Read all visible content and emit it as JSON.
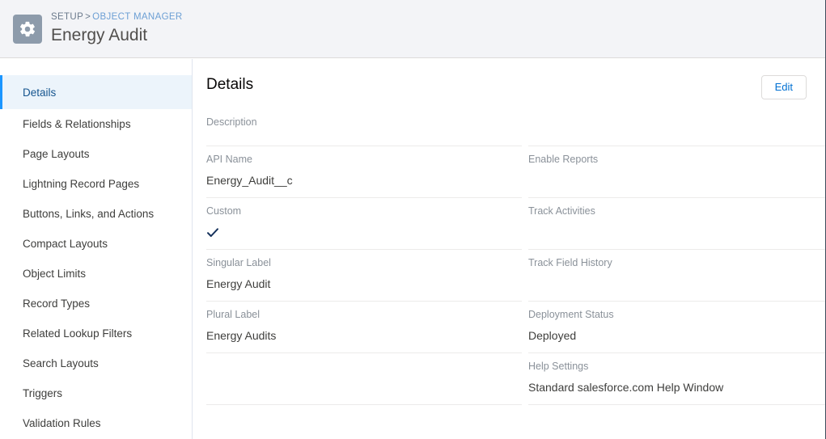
{
  "header": {
    "setup_icon": "gear-icon",
    "breadcrumb": {
      "setup_label": "SETUP",
      "separator": ">",
      "object_manager_label": "OBJECT MANAGER"
    },
    "object_title": "Energy Audit",
    "badge_color": "#8d9bab",
    "background_color": "#f3f4f7"
  },
  "sidebar": {
    "items": [
      {
        "label": "Details",
        "active": true
      },
      {
        "label": "Fields & Relationships",
        "active": false
      },
      {
        "label": "Page Layouts",
        "active": false
      },
      {
        "label": "Lightning Record Pages",
        "active": false
      },
      {
        "label": "Buttons, Links, and Actions",
        "active": false
      },
      {
        "label": "Compact Layouts",
        "active": false
      },
      {
        "label": "Object Limits",
        "active": false
      },
      {
        "label": "Record Types",
        "active": false
      },
      {
        "label": "Related Lookup Filters",
        "active": false
      },
      {
        "label": "Search Layouts",
        "active": false
      },
      {
        "label": "Triggers",
        "active": false
      },
      {
        "label": "Validation Rules",
        "active": false
      }
    ],
    "active_accent_color": "#1b96ff",
    "active_background_color": "#ecf4fb"
  },
  "main": {
    "panel_title": "Details",
    "edit_button_label": "Edit",
    "accent_link_color": "#0070d2",
    "left_column": [
      {
        "label": "Description",
        "value": "",
        "type": "text"
      },
      {
        "label": "API Name",
        "value": "Energy_Audit__c",
        "type": "text"
      },
      {
        "label": "Custom",
        "value": "",
        "type": "checkmark"
      },
      {
        "label": "Singular Label",
        "value": "Energy Audit",
        "type": "text"
      },
      {
        "label": "Plural Label",
        "value": "Energy Audits",
        "type": "text"
      },
      {
        "label": "",
        "value": "",
        "type": "text"
      }
    ],
    "right_column": [
      {
        "label": "Enable Reports",
        "value": "",
        "type": "text"
      },
      {
        "label": "Track Activities",
        "value": "",
        "type": "text"
      },
      {
        "label": "Track Field History",
        "value": "",
        "type": "text"
      },
      {
        "label": "Deployment Status",
        "value": "Deployed",
        "type": "text"
      },
      {
        "label": "Help Settings",
        "value": "Standard salesforce.com Help Window",
        "type": "text"
      }
    ]
  }
}
